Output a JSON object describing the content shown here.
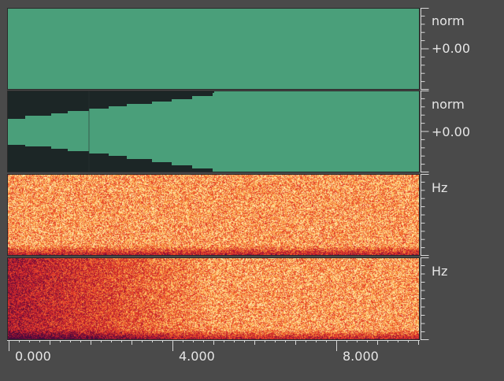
{
  "tracks": [
    {
      "kind": "waveform",
      "unit": "norm",
      "value_label": "+0.00"
    },
    {
      "kind": "waveform",
      "unit": "norm",
      "value_label": "+0.00"
    },
    {
      "kind": "spectrogram",
      "unit": "Hz"
    },
    {
      "kind": "spectrogram",
      "unit": "Hz"
    }
  ],
  "timeline": {
    "labels": [
      "0.000",
      "4.000",
      "8.000"
    ]
  },
  "colors": {
    "background": "#4a4a4a",
    "waveform": "#4a9f7a",
    "waveform_dark": "#1c2626",
    "spectro_hot": "#ffd88a",
    "spectro_cold": "#5a1a3a"
  }
}
